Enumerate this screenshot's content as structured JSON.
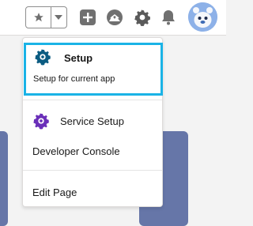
{
  "header": {
    "icons": [
      "star-icon",
      "chevron-down-icon",
      "plus-icon",
      "trailhead-icon",
      "gear-icon",
      "bell-icon",
      "avatar"
    ]
  },
  "menu": {
    "setup": {
      "title": "Setup",
      "subtitle": "Setup for current app"
    },
    "items": [
      {
        "label": "Service Setup"
      },
      {
        "label": "Developer Console"
      },
      {
        "label": "Edit Page"
      }
    ]
  },
  "colors": {
    "highlight": "#1ab3e6",
    "setup_icon": "#0b5c82",
    "service_icon": "#6a2fb9",
    "card": "#6676a8"
  }
}
